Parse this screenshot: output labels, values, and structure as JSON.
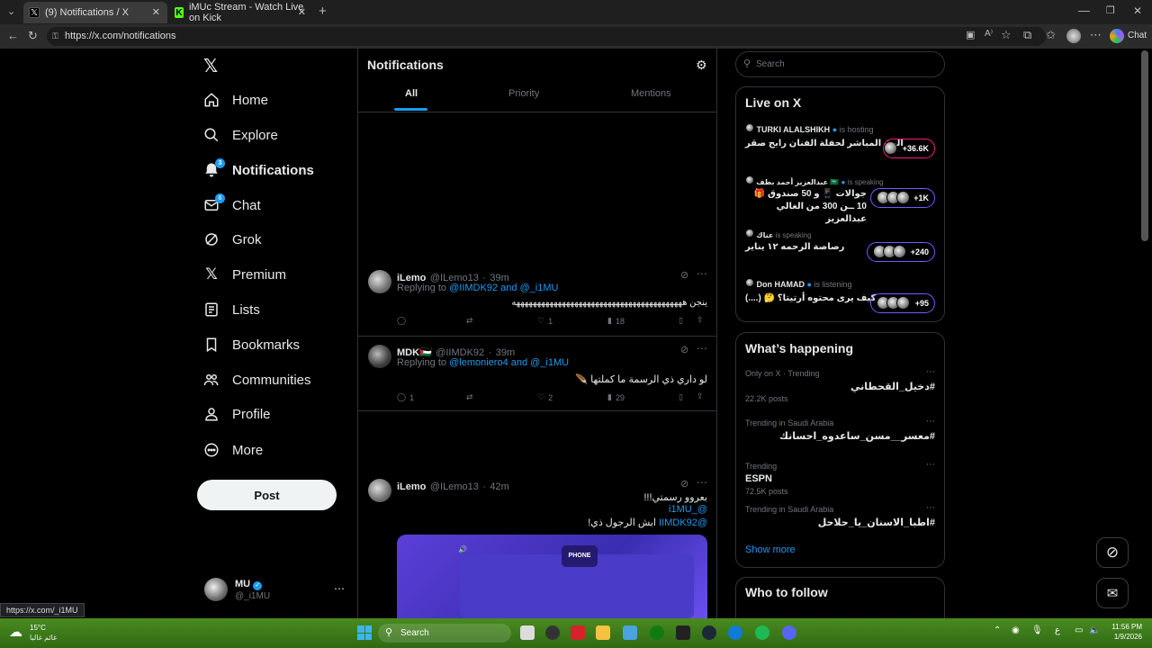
{
  "browser": {
    "tabs": [
      {
        "title": "(9) Notifications / X",
        "active": true
      },
      {
        "title": "iMUc Stream - Watch Live on Kick",
        "active": false
      }
    ],
    "url": "https://x.com/notifications",
    "chat_label": "Chat",
    "status_url": "https://x.com/_i1MU"
  },
  "nav": {
    "items": [
      {
        "label": "Home",
        "icon": "home-icon"
      },
      {
        "label": "Explore",
        "icon": "search-icon"
      },
      {
        "label": "Notifications",
        "icon": "bell-icon",
        "badge": "3"
      },
      {
        "label": "Chat",
        "icon": "mail-icon",
        "badge": "6"
      },
      {
        "label": "Grok",
        "icon": "grok-icon"
      },
      {
        "label": "Premium",
        "icon": "x-logo-icon"
      },
      {
        "label": "Lists",
        "icon": "list-icon"
      },
      {
        "label": "Bookmarks",
        "icon": "bookmark-icon"
      },
      {
        "label": "Communities",
        "icon": "communities-icon"
      },
      {
        "label": "Profile",
        "icon": "person-icon"
      },
      {
        "label": "More",
        "icon": "more-circle-icon"
      }
    ],
    "post_label": "Post",
    "account": {
      "name": "MU",
      "handle": "@_i1MU"
    }
  },
  "main": {
    "title": "Notifications",
    "tabs": [
      "All",
      "Priority",
      "Mentions"
    ],
    "tweets": [
      {
        "name": "iLemo",
        "handle": "@ILemo13",
        "time": "39m",
        "replying_prefix": "Replying to ",
        "replying_to": "@IIMDK92 and @_i1MU",
        "text": "ينجن هههههههههههههههههههههههههههههههههههههههههه",
        "replies": "",
        "retweets": "",
        "likes": "1",
        "views": "18"
      },
      {
        "name": "MDK🇵🇸",
        "handle": "@IIMDK92",
        "time": "39m",
        "replying_prefix": "Replying to ",
        "replying_to": "@lemoniero4 and @_i1MU",
        "text": "لو داري ذي الرسمة ما كملتها 🪶",
        "replies": "1",
        "retweets": "",
        "likes": "2",
        "views": "29"
      },
      {
        "name": "iLemo",
        "handle": "@ILemo13",
        "time": "42m",
        "line1": "بعروو رسمتي!!!",
        "mention1": "@_i1MU",
        "mention2": "@IIMDK92",
        "line3": "ابش الرجول ذي!"
      }
    ]
  },
  "right": {
    "search_placeholder": "Search",
    "live": {
      "title": "Live on X",
      "items": [
        {
          "host": "TURKI ALALSHIKH",
          "status": "is hosting",
          "text": "البث المباشر لحفلة الفنان رابح صقر",
          "count": "+36.6K"
        },
        {
          "host": "عبدالعزيز أحمد بطف 🇸🇦",
          "status": "is speaking",
          "text": "جوالات 📱 و 50 صندوق 🎁 10 ــن 300 من الغالي عبدالعزيز",
          "count": "+1K"
        },
        {
          "host": "عناك",
          "status": "is speaking",
          "text": "رصاصة الرحمه ١٢ يناير",
          "count": "+240"
        },
        {
          "host": "Don HAMAD",
          "status": "is listening",
          "text": "كيف يرى محتوه أرتيتا؟ 🤔 (....)",
          "count": "+95"
        }
      ]
    },
    "trends": {
      "title": "What’s happening",
      "items": [
        {
          "meta": "Only on X · Trending",
          "name": "#دخيل_القحطاني",
          "posts": "22.2K posts"
        },
        {
          "meta": "Trending in Saudi Arabia",
          "name": "#معسر__مسن_ساعدوه_احسانك",
          "posts": ""
        },
        {
          "meta": "Trending",
          "name": "ESPN",
          "posts": "72.5K posts"
        },
        {
          "meta": "Trending in Saudi Arabia",
          "name": "#اطبا_الاسنان_يا_حلاحل",
          "posts": ""
        }
      ],
      "show_more": "Show more"
    },
    "who_to_follow": "Who to follow"
  },
  "taskbar": {
    "weather_temp": "15°C",
    "weather_desc": "غائم غالبا",
    "search": "Search",
    "time": "11:56 PM",
    "date": "1/9/2026",
    "lang": "ع"
  }
}
